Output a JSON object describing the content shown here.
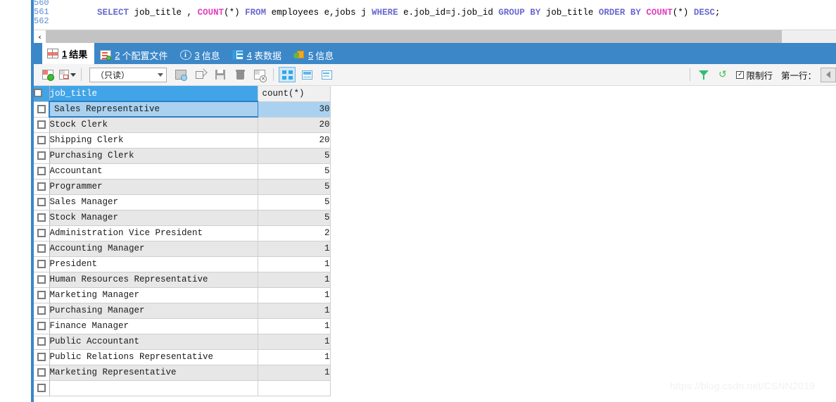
{
  "editor": {
    "line_numbers": [
      "560",
      "561",
      "562"
    ],
    "sql_tokens": [
      {
        "t": "    ",
        "k": "plain"
      },
      {
        "t": "SELECT",
        "k": "kw"
      },
      {
        "t": " job_title , ",
        "k": "plain"
      },
      {
        "t": "COUNT",
        "k": "fn"
      },
      {
        "t": "(*)",
        "k": "plain"
      },
      {
        "t": " ",
        "k": "plain"
      },
      {
        "t": "FROM",
        "k": "kw"
      },
      {
        "t": " employees e,jobs j ",
        "k": "plain"
      },
      {
        "t": "WHERE",
        "k": "kw"
      },
      {
        "t": " e.job_id=j.job_id ",
        "k": "plain"
      },
      {
        "t": "GROUP BY",
        "k": "kw"
      },
      {
        "t": " job_title ",
        "k": "plain"
      },
      {
        "t": "ORDER BY",
        "k": "kw"
      },
      {
        "t": " ",
        "k": "plain"
      },
      {
        "t": "COUNT",
        "k": "fn"
      },
      {
        "t": "(*)",
        "k": "plain"
      },
      {
        "t": " ",
        "k": "plain"
      },
      {
        "t": "DESC",
        "k": "kw"
      },
      {
        "t": ";",
        "k": "plain"
      }
    ],
    "sql_plain": "    SELECT job_title , COUNT(*) FROM employees e,jobs j WHERE e.job_id=j.job_id GROUP BY job_title ORDER BY COUNT(*) DESC;",
    "scroll_left_arrow": "‹"
  },
  "tabs": [
    {
      "num": "1",
      "label": "结果",
      "icon": "results-grid-icon",
      "active": true
    },
    {
      "num": "2",
      "label": "个配置文件",
      "icon": "profile-icon",
      "active": false
    },
    {
      "num": "3",
      "label": "信息",
      "icon": "info-circle-icon",
      "active": false
    },
    {
      "num": "4",
      "label": "表数据",
      "icon": "table-data-icon",
      "active": false
    },
    {
      "num": "5",
      "label": "信息",
      "icon": "status-pie-icon",
      "active": false
    }
  ],
  "toolbar": {
    "mode_select_value": "（只读）",
    "limit_rows_label": "限制行",
    "limit_rows_checked": true,
    "first_row_label": "第一行：",
    "buttons": [
      {
        "name": "add-record-button",
        "icon": "grid-add-icon"
      },
      {
        "name": "delete-record-button",
        "icon": "grid-delete-icon"
      },
      {
        "name": "import-button",
        "icon": "import-icon"
      },
      {
        "name": "export-button",
        "icon": "export-icon"
      },
      {
        "name": "save-button",
        "icon": "save-icon"
      },
      {
        "name": "delete-button",
        "icon": "trash-icon"
      },
      {
        "name": "revert-button",
        "icon": "grid-revert-icon"
      },
      {
        "name": "view-grid-button",
        "icon": "view-grid-icon"
      },
      {
        "name": "view-form-button",
        "icon": "view-form-icon"
      },
      {
        "name": "view-text-button",
        "icon": "view-text-icon"
      },
      {
        "name": "filter-button",
        "icon": "filter-icon"
      },
      {
        "name": "refresh-button",
        "icon": "refresh-icon"
      }
    ]
  },
  "grid": {
    "columns": [
      "job_title",
      "count(*)"
    ],
    "selected_row_index": 0,
    "rows": [
      {
        "job_title": "Sales Representative",
        "count": "30"
      },
      {
        "job_title": "Stock Clerk",
        "count": "20"
      },
      {
        "job_title": "Shipping Clerk",
        "count": "20"
      },
      {
        "job_title": "Purchasing Clerk",
        "count": "5"
      },
      {
        "job_title": "Accountant",
        "count": "5"
      },
      {
        "job_title": "Programmer",
        "count": "5"
      },
      {
        "job_title": "Sales Manager",
        "count": "5"
      },
      {
        "job_title": "Stock Manager",
        "count": "5"
      },
      {
        "job_title": "Administration Vice President",
        "count": "2"
      },
      {
        "job_title": "Accounting Manager",
        "count": "1"
      },
      {
        "job_title": "President",
        "count": "1"
      },
      {
        "job_title": "Human Resources Representative",
        "count": "1"
      },
      {
        "job_title": "Marketing Manager",
        "count": "1"
      },
      {
        "job_title": "Purchasing Manager",
        "count": "1"
      },
      {
        "job_title": "Finance Manager",
        "count": "1"
      },
      {
        "job_title": "Public Accountant",
        "count": "1"
      },
      {
        "job_title": "Public Relations Representative",
        "count": "1"
      },
      {
        "job_title": "Marketing Representative",
        "count": "1"
      },
      {
        "job_title": "",
        "count": ""
      }
    ]
  },
  "watermark": "https://blog.csdn.net/CSNN2019",
  "colors": {
    "accent_blue": "#3b87c8",
    "header_blue": "#41a4e8",
    "selection_blue": "#aad2f0",
    "row_alt": "#e7e7e7",
    "keyword_purple": "#6a6ad1",
    "function_pink": "#e040c0"
  }
}
